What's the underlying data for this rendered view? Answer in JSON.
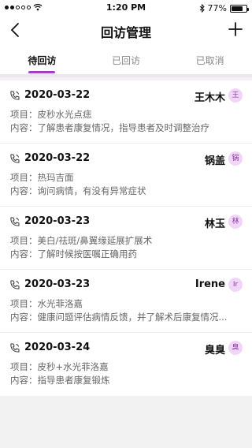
{
  "status_bar": {
    "time": "1:20 PM",
    "battery_text": "77%",
    "battery_level": 0.77,
    "icons": [
      "signal-dots-icon",
      "wifi-icon",
      "bluetooth-icon",
      "battery-icon"
    ]
  },
  "nav": {
    "title": "回访管理",
    "back_icon": "chevron-left-icon",
    "add_icon": "plus-icon"
  },
  "tabs": [
    {
      "label": "待回访",
      "active": true
    },
    {
      "label": "已回访",
      "active": false
    },
    {
      "label": "已取消",
      "active": false
    }
  ],
  "accent_color": "#a53fc9",
  "items": [
    {
      "date": "2020-03-22",
      "name": "王木木",
      "avatar": "王",
      "project": "项目：皮秒水光点痣",
      "content": "内容：了解患者康复情况，指导患者及时调整治疗"
    },
    {
      "date": "2020-03-22",
      "name": "锅盖",
      "avatar": "锅",
      "project": "项目：热玛吉面",
      "content": "内容：询问病情，有没有异常症状"
    },
    {
      "date": "2020-03-23",
      "name": "林玉",
      "avatar": "林",
      "project": "项目：美白/祛斑/鼻翼缘延展扩展术",
      "content": "内容：了解时候按医嘱正确用药"
    },
    {
      "date": "2020-03-23",
      "name": "Irene",
      "avatar": "Ir",
      "project": "项目：水光菲洛嘉",
      "content": "内容：健康问题评估病情反馈，并了解术后康复情况..."
    },
    {
      "date": "2020-03-24",
      "name": "臭臭",
      "avatar": "臭",
      "project": "项目：皮秒+水光菲洛嘉",
      "content": "内容：指导患者康复锻炼"
    }
  ]
}
